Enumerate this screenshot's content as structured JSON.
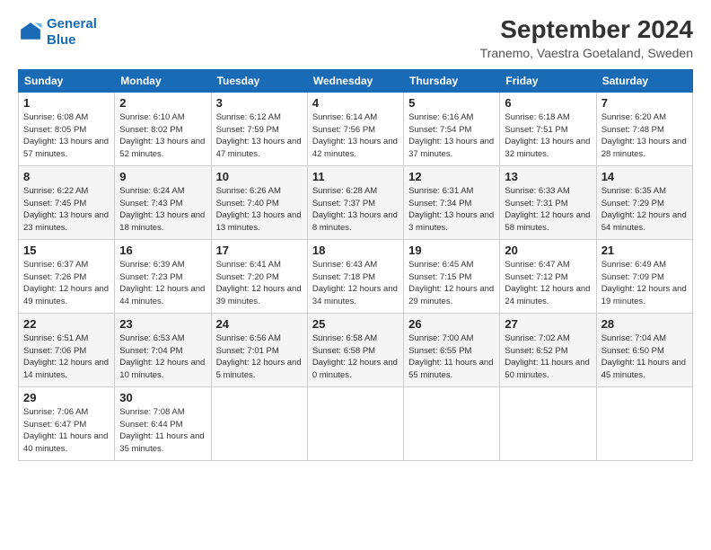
{
  "header": {
    "logo_line1": "General",
    "logo_line2": "Blue",
    "title": "September 2024",
    "subtitle": "Tranemo, Vaestra Goetaland, Sweden"
  },
  "columns": [
    "Sunday",
    "Monday",
    "Tuesday",
    "Wednesday",
    "Thursday",
    "Friday",
    "Saturday"
  ],
  "weeks": [
    [
      {
        "day": "1",
        "sunrise": "6:08 AM",
        "sunset": "8:05 PM",
        "daylight": "13 hours and 57 minutes."
      },
      {
        "day": "2",
        "sunrise": "6:10 AM",
        "sunset": "8:02 PM",
        "daylight": "13 hours and 52 minutes."
      },
      {
        "day": "3",
        "sunrise": "6:12 AM",
        "sunset": "7:59 PM",
        "daylight": "13 hours and 47 minutes."
      },
      {
        "day": "4",
        "sunrise": "6:14 AM",
        "sunset": "7:56 PM",
        "daylight": "13 hours and 42 minutes."
      },
      {
        "day": "5",
        "sunrise": "6:16 AM",
        "sunset": "7:54 PM",
        "daylight": "13 hours and 37 minutes."
      },
      {
        "day": "6",
        "sunrise": "6:18 AM",
        "sunset": "7:51 PM",
        "daylight": "13 hours and 32 minutes."
      },
      {
        "day": "7",
        "sunrise": "6:20 AM",
        "sunset": "7:48 PM",
        "daylight": "13 hours and 28 minutes."
      }
    ],
    [
      {
        "day": "8",
        "sunrise": "6:22 AM",
        "sunset": "7:45 PM",
        "daylight": "13 hours and 23 minutes."
      },
      {
        "day": "9",
        "sunrise": "6:24 AM",
        "sunset": "7:43 PM",
        "daylight": "13 hours and 18 minutes."
      },
      {
        "day": "10",
        "sunrise": "6:26 AM",
        "sunset": "7:40 PM",
        "daylight": "13 hours and 13 minutes."
      },
      {
        "day": "11",
        "sunrise": "6:28 AM",
        "sunset": "7:37 PM",
        "daylight": "13 hours and 8 minutes."
      },
      {
        "day": "12",
        "sunrise": "6:31 AM",
        "sunset": "7:34 PM",
        "daylight": "13 hours and 3 minutes."
      },
      {
        "day": "13",
        "sunrise": "6:33 AM",
        "sunset": "7:31 PM",
        "daylight": "12 hours and 58 minutes."
      },
      {
        "day": "14",
        "sunrise": "6:35 AM",
        "sunset": "7:29 PM",
        "daylight": "12 hours and 54 minutes."
      }
    ],
    [
      {
        "day": "15",
        "sunrise": "6:37 AM",
        "sunset": "7:26 PM",
        "daylight": "12 hours and 49 minutes."
      },
      {
        "day": "16",
        "sunrise": "6:39 AM",
        "sunset": "7:23 PM",
        "daylight": "12 hours and 44 minutes."
      },
      {
        "day": "17",
        "sunrise": "6:41 AM",
        "sunset": "7:20 PM",
        "daylight": "12 hours and 39 minutes."
      },
      {
        "day": "18",
        "sunrise": "6:43 AM",
        "sunset": "7:18 PM",
        "daylight": "12 hours and 34 minutes."
      },
      {
        "day": "19",
        "sunrise": "6:45 AM",
        "sunset": "7:15 PM",
        "daylight": "12 hours and 29 minutes."
      },
      {
        "day": "20",
        "sunrise": "6:47 AM",
        "sunset": "7:12 PM",
        "daylight": "12 hours and 24 minutes."
      },
      {
        "day": "21",
        "sunrise": "6:49 AM",
        "sunset": "7:09 PM",
        "daylight": "12 hours and 19 minutes."
      }
    ],
    [
      {
        "day": "22",
        "sunrise": "6:51 AM",
        "sunset": "7:06 PM",
        "daylight": "12 hours and 14 minutes."
      },
      {
        "day": "23",
        "sunrise": "6:53 AM",
        "sunset": "7:04 PM",
        "daylight": "12 hours and 10 minutes."
      },
      {
        "day": "24",
        "sunrise": "6:56 AM",
        "sunset": "7:01 PM",
        "daylight": "12 hours and 5 minutes."
      },
      {
        "day": "25",
        "sunrise": "6:58 AM",
        "sunset": "6:58 PM",
        "daylight": "12 hours and 0 minutes."
      },
      {
        "day": "26",
        "sunrise": "7:00 AM",
        "sunset": "6:55 PM",
        "daylight": "11 hours and 55 minutes."
      },
      {
        "day": "27",
        "sunrise": "7:02 AM",
        "sunset": "6:52 PM",
        "daylight": "11 hours and 50 minutes."
      },
      {
        "day": "28",
        "sunrise": "7:04 AM",
        "sunset": "6:50 PM",
        "daylight": "11 hours and 45 minutes."
      }
    ],
    [
      {
        "day": "29",
        "sunrise": "7:06 AM",
        "sunset": "6:47 PM",
        "daylight": "11 hours and 40 minutes."
      },
      {
        "day": "30",
        "sunrise": "7:08 AM",
        "sunset": "6:44 PM",
        "daylight": "11 hours and 35 minutes."
      },
      null,
      null,
      null,
      null,
      null
    ]
  ]
}
